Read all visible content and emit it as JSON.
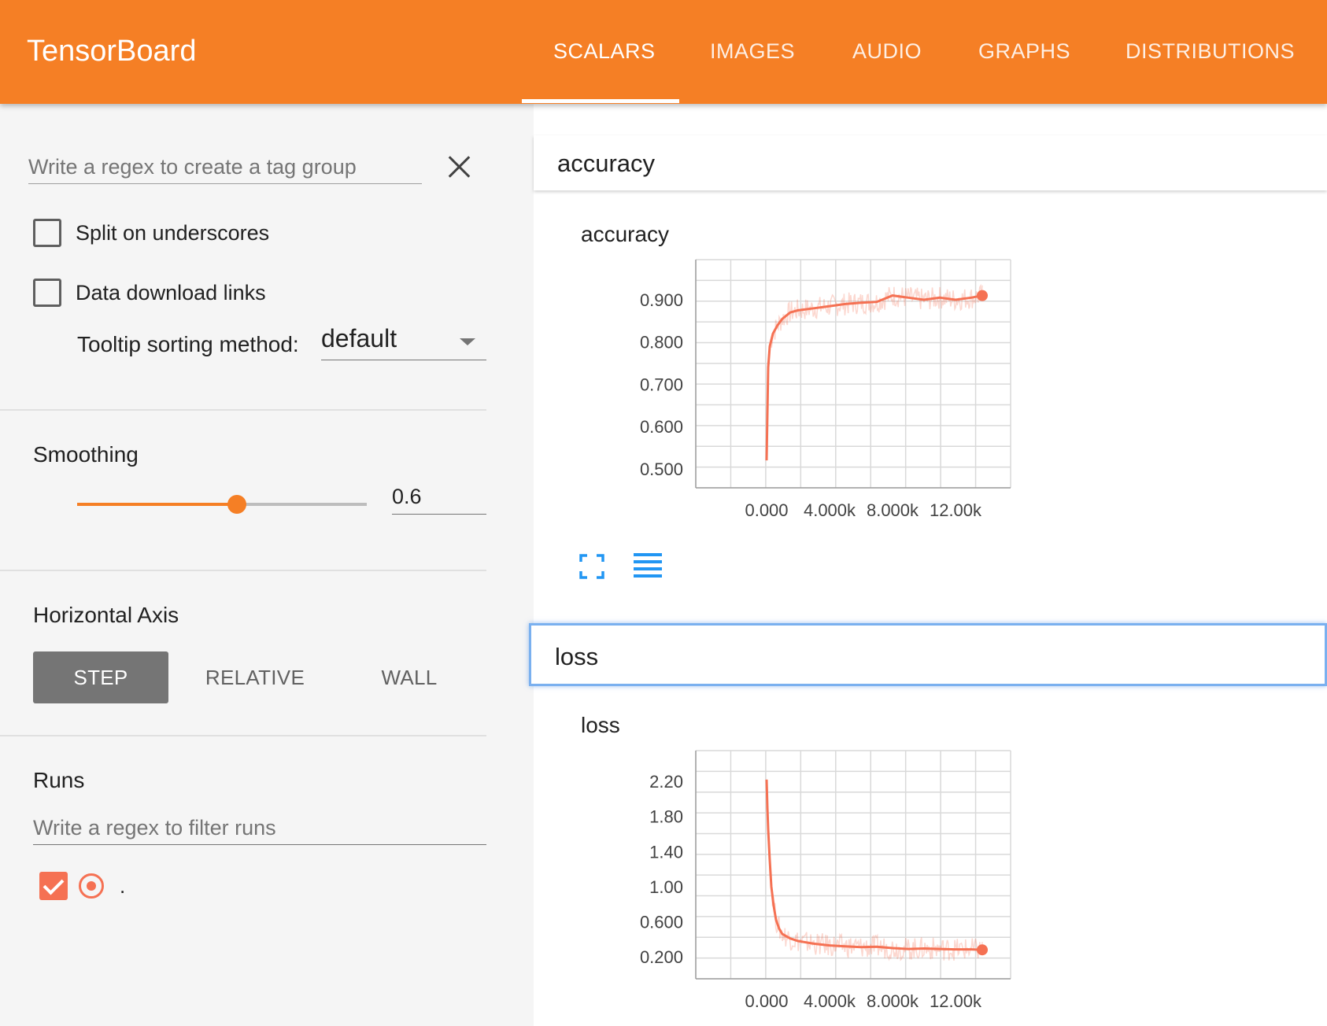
{
  "header": {
    "brand": "TensorBoard",
    "tabs": [
      {
        "label": "SCALARS",
        "active": true
      },
      {
        "label": "IMAGES",
        "active": false
      },
      {
        "label": "AUDIO",
        "active": false
      },
      {
        "label": "GRAPHS",
        "active": false
      },
      {
        "label": "DISTRIBUTIONS",
        "active": false
      }
    ],
    "color": "#f57f25"
  },
  "sidebar": {
    "tag_regex_placeholder": "Write a regex to create a tag group",
    "split_underscores": {
      "label": "Split on underscores",
      "checked": false
    },
    "download_links": {
      "label": "Data download links",
      "checked": false
    },
    "tooltip_sort": {
      "label": "Tooltip sorting method:",
      "value": "default"
    },
    "smoothing": {
      "title": "Smoothing",
      "value": "0.6",
      "fraction": 0.6
    },
    "horizontal_axis": {
      "title": "Horizontal Axis",
      "options": [
        {
          "label": "STEP",
          "active": true
        },
        {
          "label": "RELATIVE",
          "active": false
        },
        {
          "label": "WALL",
          "active": false
        }
      ]
    },
    "runs": {
      "title": "Runs",
      "filter_placeholder": "Write a regex to filter runs",
      "items": [
        {
          "name": ".",
          "checked": true,
          "color": "#f57153"
        }
      ]
    }
  },
  "main": {
    "cards": [
      {
        "header": "accuracy",
        "chart_title": "accuracy"
      },
      {
        "header": "loss",
        "chart_title": "loss"
      }
    ]
  },
  "chart_data": [
    {
      "type": "line",
      "title": "accuracy",
      "xlabel": "",
      "ylabel": "",
      "xlim": [
        -4500,
        15500
      ],
      "ylim": [
        0.455,
        0.995
      ],
      "x_ticks": [
        0,
        4000,
        8000,
        12000
      ],
      "x_tick_labels": [
        "0.000",
        "4.000k",
        "8.000k",
        "12.00k"
      ],
      "y_ticks": [
        0.9,
        0.8,
        0.7,
        0.6,
        0.5
      ],
      "y_tick_labels": [
        "0.900",
        "0.800",
        "0.700",
        "0.600",
        "0.500"
      ],
      "grid": true,
      "color": "#f57153",
      "series": [
        {
          "smoothed": true,
          "x": [
            0,
            100,
            200,
            400,
            700,
            1000,
            1500,
            2000,
            3000,
            4000,
            5000,
            6000,
            7000,
            8000,
            9000,
            10000,
            11000,
            12000,
            13000,
            13700
          ],
          "y": [
            0.52,
            0.74,
            0.79,
            0.82,
            0.84,
            0.855,
            0.87,
            0.875,
            0.88,
            0.885,
            0.89,
            0.893,
            0.895,
            0.91,
            0.905,
            0.9,
            0.905,
            0.9,
            0.905,
            0.91
          ]
        }
      ]
    },
    {
      "type": "line",
      "title": "loss",
      "xlabel": "",
      "ylabel": "",
      "xlim": [
        -4500,
        15500
      ],
      "ylim": [
        -0.05,
        2.55
      ],
      "x_ticks": [
        0,
        4000,
        8000,
        12000
      ],
      "x_tick_labels": [
        "0.000",
        "4.000k",
        "8.000k",
        "12.00k"
      ],
      "y_ticks": [
        2.2,
        1.8,
        1.4,
        1.0,
        0.6,
        0.2
      ],
      "y_tick_labels": [
        "2.20",
        "1.80",
        "1.40",
        "1.00",
        "0.600",
        "0.200"
      ],
      "grid": true,
      "color": "#f57153",
      "series": [
        {
          "smoothed": true,
          "x": [
            0,
            50,
            100,
            200,
            300,
            450,
            600,
            800,
            1000,
            1500,
            2000,
            3000,
            4000,
            5000,
            6000,
            7000,
            8000,
            9000,
            10000,
            11000,
            12000,
            13000,
            13700
          ],
          "y": [
            2.22,
            1.9,
            1.65,
            1.3,
            1.0,
            0.78,
            0.62,
            0.52,
            0.46,
            0.41,
            0.38,
            0.35,
            0.33,
            0.32,
            0.31,
            0.315,
            0.3,
            0.29,
            0.295,
            0.29,
            0.285,
            0.285,
            0.28
          ]
        }
      ]
    }
  ]
}
